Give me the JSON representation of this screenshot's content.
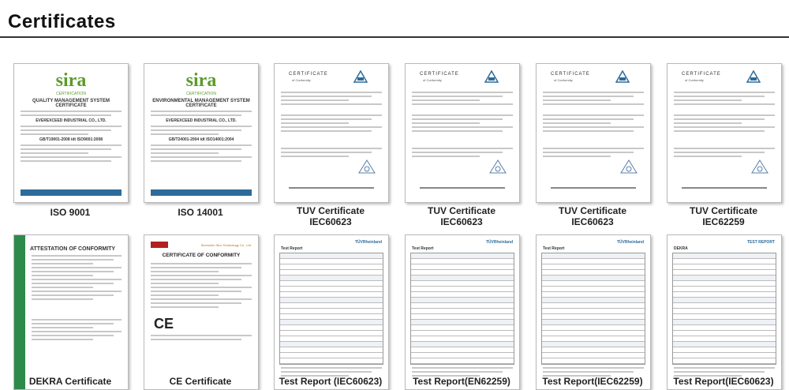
{
  "heading": "Certificates",
  "certificates": [
    {
      "caption1": "ISO 9001",
      "caption2": "",
      "brand": "sira",
      "doc_title1": "QUALITY MANAGEMENT SYSTEM",
      "doc_title2": "CERTIFICATE",
      "standard": "GB/T19001-2008 idt ISO9001:2008",
      "company": "EVEREXCEED INDUSTRIAL CO., LTD."
    },
    {
      "caption1": "ISO 14001",
      "caption2": "",
      "brand": "sira",
      "doc_title1": "ENVIRONMENTAL MANAGEMENT SYSTEM",
      "doc_title2": "CERTIFICATE",
      "standard": "GB/T24001-2004 idt ISO14001:2004",
      "company": "EVEREXCEED INDUSTRIAL CO., LTD."
    },
    {
      "caption1": "TUV Certificate",
      "caption2": "IEC60623",
      "brand": "tuv",
      "doc_title1": "CERTIFICATE",
      "doc_title2": "of Conformity"
    },
    {
      "caption1": "TUV Certificate",
      "caption2": "IEC60623",
      "brand": "tuv",
      "doc_title1": "CERTIFICATE",
      "doc_title2": "of Conformity"
    },
    {
      "caption1": "TUV Certificate",
      "caption2": "IEC60623",
      "brand": "tuv",
      "doc_title1": "CERTIFICATE",
      "doc_title2": "of Conformity"
    },
    {
      "caption1": "TUV Certificate",
      "caption2": "IEC62259",
      "brand": "tuv",
      "doc_title1": "CERTIFICATE",
      "doc_title2": "of Conformity"
    },
    {
      "caption1": "DEKRA Certificate",
      "caption2": "",
      "brand": "dekra",
      "doc_title1": "ATTESTATION OF CONFORMITY",
      "doc_title2": ""
    },
    {
      "caption1": "CE Certificate",
      "caption2": "",
      "brand": "ce",
      "doc_title1": "CERTIFICATE OF CONFORMITY",
      "doc_title2": "Shenzhen Sinc Technology Co., Ltd."
    },
    {
      "caption1": "Test Report (IEC60623)",
      "caption2": "",
      "brand": "report",
      "doc_title1": "TÜVRheinland",
      "doc_title2": "Test Report"
    },
    {
      "caption1": "Test Report(EN62259)",
      "caption2": "",
      "brand": "report",
      "doc_title1": "TÜVRheinland",
      "doc_title2": "Test Report"
    },
    {
      "caption1": "Test Report(IEC62259)",
      "caption2": "",
      "brand": "report",
      "doc_title1": "TÜVRheinland",
      "doc_title2": "Test Report"
    },
    {
      "caption1": "Test Report(IEC60623)",
      "caption2": "",
      "brand": "dekra-report",
      "doc_title1": "TEST REPORT",
      "doc_title2": "DEKRA"
    }
  ],
  "colors": {
    "sira_green": "#5a9b2a",
    "tuv_blue": "#2d6b9a",
    "dekra_green": "#2d8a4a"
  }
}
